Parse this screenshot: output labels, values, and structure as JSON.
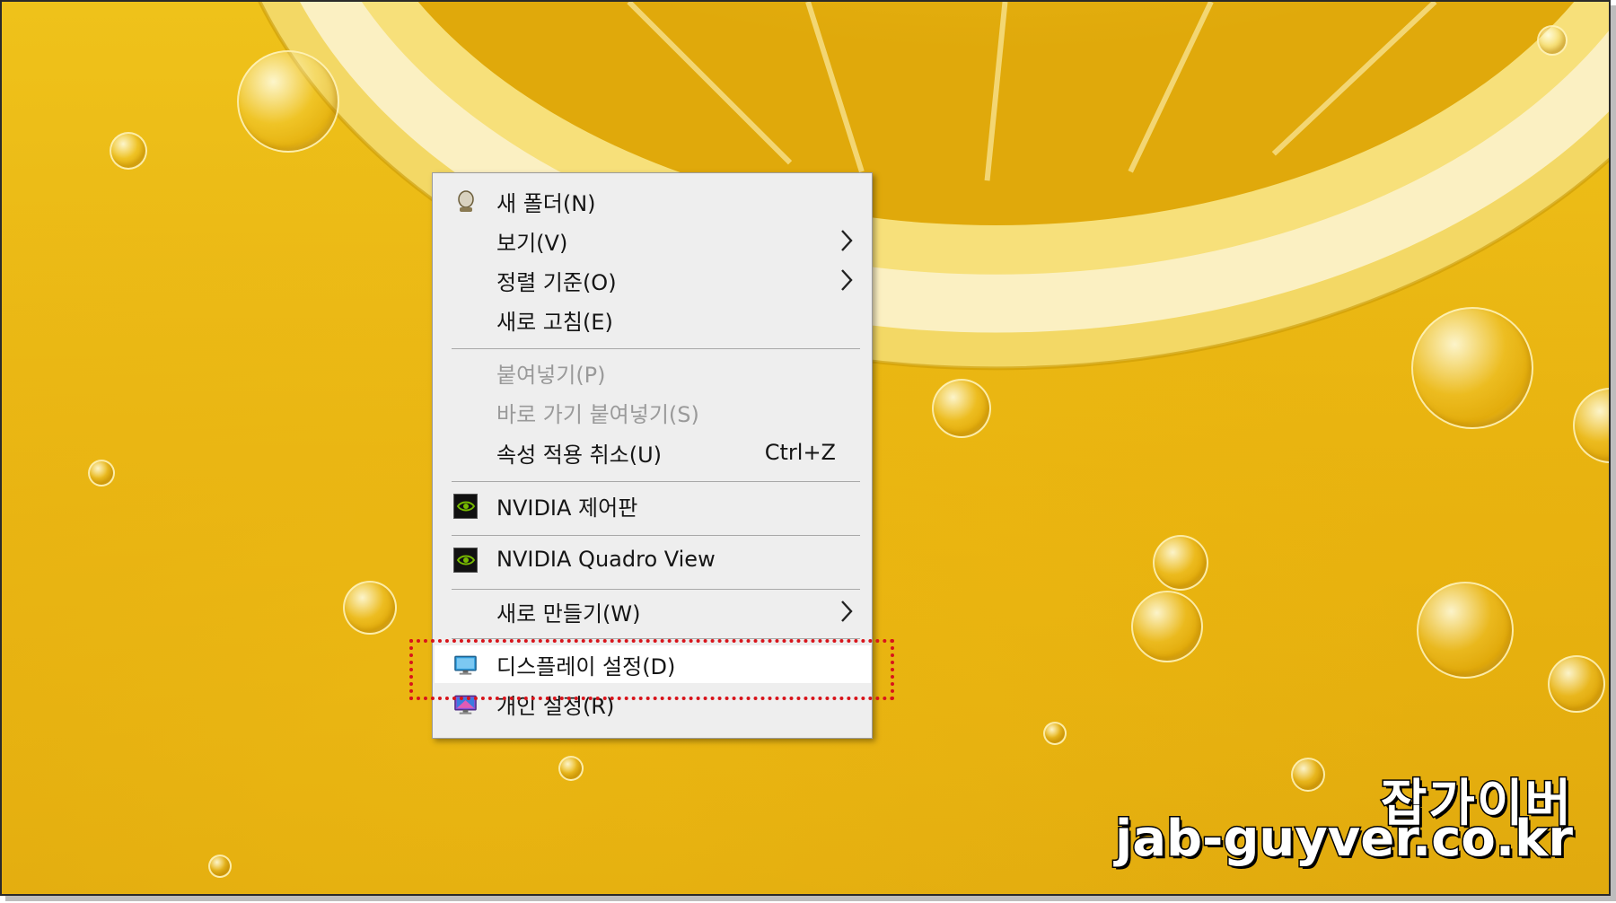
{
  "context_menu": {
    "items": [
      {
        "label": "새 폴더(N)",
        "icon": "new-folder-icon",
        "enabled": true
      },
      {
        "label": "보기(V)",
        "submenu": true,
        "enabled": true
      },
      {
        "label": "정렬 기준(O)",
        "submenu": true,
        "enabled": true
      },
      {
        "label": "새로 고침(E)",
        "enabled": true
      },
      {
        "label": "붙여넣기(P)",
        "enabled": false
      },
      {
        "label": "바로 가기 붙여넣기(S)",
        "enabled": false
      },
      {
        "label": "속성 적용 취소(U)",
        "shortcut": "Ctrl+Z",
        "enabled": true
      },
      {
        "label": "NVIDIA 제어판",
        "icon": "nvidia-icon",
        "enabled": true
      },
      {
        "label": "NVIDIA Quadro View",
        "icon": "nvidia-icon",
        "enabled": true
      },
      {
        "label": "새로 만들기(W)",
        "submenu": true,
        "enabled": true
      },
      {
        "label": "디스플레이 설정(D)",
        "icon": "display-settings-icon",
        "enabled": true,
        "highlighted": true
      },
      {
        "label": "개인 설정(R)",
        "icon": "personalize-icon",
        "enabled": true
      }
    ]
  },
  "watermark": {
    "line1": "잡가이버",
    "line2": "jab-guyver.co.kr"
  },
  "colors": {
    "menu_bg": "#eeeeee",
    "highlight_bg": "#ffffff",
    "focus_box": "#d8141b",
    "wallpaper": "#e9b513"
  }
}
